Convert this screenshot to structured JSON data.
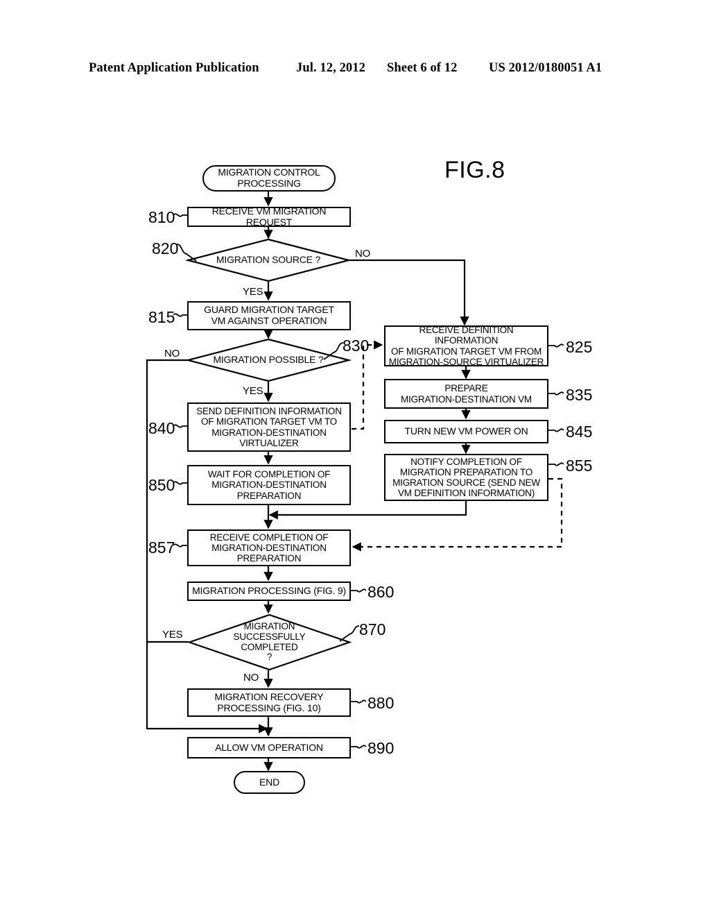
{
  "header": {
    "publication": "Patent Application Publication",
    "date": "Jul. 12, 2012",
    "sheet": "Sheet 6 of 12",
    "patent_number": "US 2012/0180051 A1"
  },
  "figure": {
    "title": "FIG.8"
  },
  "chart_data": {
    "type": "diagram",
    "title": "FIG.8",
    "nodes": [
      {
        "id": "start",
        "ref": "",
        "shape": "terminator",
        "text": "MIGRATION CONTROL PROCESSING"
      },
      {
        "id": "810",
        "ref": "810",
        "shape": "process",
        "text": "RECEIVE VM MIGRATION REQUEST"
      },
      {
        "id": "820",
        "ref": "820",
        "shape": "decision",
        "text": "MIGRATION SOURCE ?"
      },
      {
        "id": "815",
        "ref": "815",
        "shape": "process",
        "text": "GUARD MIGRATION TARGET VM AGAINST OPERATION"
      },
      {
        "id": "830",
        "ref": "830",
        "shape": "decision",
        "text": "MIGRATION POSSIBLE ?"
      },
      {
        "id": "840",
        "ref": "840",
        "shape": "process",
        "text": "SEND DEFINITION INFORMATION OF MIGRATION TARGET VM TO MIGRATION-DESTINATION VIRTUALIZER"
      },
      {
        "id": "850",
        "ref": "850",
        "shape": "process",
        "text": "WAIT FOR COMPLETION OF MIGRATION-DESTINATION PREPARATION"
      },
      {
        "id": "857",
        "ref": "857",
        "shape": "process",
        "text": "RECEIVE COMPLETION OF MIGRATION-DESTINATION PREPARATION"
      },
      {
        "id": "860",
        "ref": "860",
        "shape": "process",
        "text": "MIGRATION PROCESSING (FIG. 9)"
      },
      {
        "id": "870",
        "ref": "870",
        "shape": "decision",
        "text": "MIGRATION SUCCESSFULLY COMPLETED ?"
      },
      {
        "id": "880",
        "ref": "880",
        "shape": "process",
        "text": "MIGRATION RECOVERY PROCESSING (FIG. 10)"
      },
      {
        "id": "890",
        "ref": "890",
        "shape": "process",
        "text": "ALLOW VM OPERATION"
      },
      {
        "id": "end",
        "ref": "",
        "shape": "terminator",
        "text": "END"
      },
      {
        "id": "825",
        "ref": "825",
        "shape": "process",
        "text": "RECEIVE DEFINITION INFORMATION OF MIGRATION TARGET VM FROM MIGRATION-SOURCE VIRTUALIZER"
      },
      {
        "id": "835",
        "ref": "835",
        "shape": "process",
        "text": "PREPARE MIGRATION-DESTINATION VM"
      },
      {
        "id": "845",
        "ref": "845",
        "shape": "process",
        "text": "TURN NEW VM POWER ON"
      },
      {
        "id": "855",
        "ref": "855",
        "shape": "process",
        "text": "NOTIFY COMPLETION OF MIGRATION PREPARATION TO MIGRATION SOURCE (SEND NEW VM DEFINITION INFORMATION)"
      }
    ],
    "edges": [
      {
        "from": "start",
        "to": "810",
        "label": ""
      },
      {
        "from": "810",
        "to": "820",
        "label": ""
      },
      {
        "from": "820",
        "to": "815",
        "label": "YES"
      },
      {
        "from": "820",
        "to": "825",
        "label": "NO"
      },
      {
        "from": "815",
        "to": "830",
        "label": ""
      },
      {
        "from": "830",
        "to": "840",
        "label": "YES"
      },
      {
        "from": "830",
        "to": "890",
        "label": "NO"
      },
      {
        "from": "840",
        "to": "850",
        "label": ""
      },
      {
        "from": "840",
        "to": "825",
        "label": "",
        "style": "dashed"
      },
      {
        "from": "850",
        "to": "857",
        "label": ""
      },
      {
        "from": "825",
        "to": "835",
        "label": ""
      },
      {
        "from": "835",
        "to": "845",
        "label": ""
      },
      {
        "from": "845",
        "to": "855",
        "label": ""
      },
      {
        "from": "855",
        "to": "857",
        "label": ""
      },
      {
        "from": "855",
        "to": "857",
        "label": "",
        "style": "dashed"
      },
      {
        "from": "857",
        "to": "860",
        "label": ""
      },
      {
        "from": "860",
        "to": "870",
        "label": ""
      },
      {
        "from": "870",
        "to": "890",
        "label": "YES"
      },
      {
        "from": "870",
        "to": "880",
        "label": "NO"
      },
      {
        "from": "880",
        "to": "890",
        "label": ""
      },
      {
        "from": "890",
        "to": "end",
        "label": ""
      }
    ]
  },
  "nodes": {
    "start": {
      "text": "MIGRATION CONTROL\nPROCESSING"
    },
    "n810": {
      "ref": "810",
      "text": "RECEIVE VM MIGRATION REQUEST"
    },
    "n820": {
      "ref": "820",
      "text": "MIGRATION SOURCE ?"
    },
    "n815": {
      "ref": "815",
      "text": "GUARD MIGRATION TARGET\nVM AGAINST OPERATION"
    },
    "n830": {
      "ref": "830",
      "text": "MIGRATION POSSIBLE ?"
    },
    "n840": {
      "ref": "840",
      "text": "SEND DEFINITION INFORMATION\nOF MIGRATION TARGET VM TO\nMIGRATION-DESTINATION\nVIRTUALIZER"
    },
    "n850": {
      "ref": "850",
      "text": "WAIT FOR COMPLETION OF\nMIGRATION-DESTINATION\nPREPARATION"
    },
    "n857": {
      "ref": "857",
      "text": "RECEIVE COMPLETION OF\nMIGRATION-DESTINATION\nPREPARATION"
    },
    "n860": {
      "ref": "860",
      "text": "MIGRATION PROCESSING (FIG. 9)"
    },
    "n870": {
      "ref": "870",
      "text": "MIGRATION\nSUCCESSFULLY\nCOMPLETED\n?"
    },
    "n880": {
      "ref": "880",
      "text": "MIGRATION RECOVERY\nPROCESSING (FIG. 10)"
    },
    "n890": {
      "ref": "890",
      "text": "ALLOW VM OPERATION"
    },
    "end": {
      "text": "END"
    },
    "n825": {
      "ref": "825",
      "text": "RECEIVE DEFINITION INFORMATION\nOF MIGRATION TARGET VM FROM\nMIGRATION-SOURCE VIRTUALIZER"
    },
    "n835": {
      "ref": "835",
      "text": "PREPARE\nMIGRATION-DESTINATION VM"
    },
    "n845": {
      "ref": "845",
      "text": "TURN NEW VM POWER ON"
    },
    "n855": {
      "ref": "855",
      "text": "NOTIFY COMPLETION OF\nMIGRATION PREPARATION TO\nMIGRATION SOURCE (SEND NEW\nVM DEFINITION INFORMATION)"
    }
  },
  "branch_labels": {
    "b820_no": "NO",
    "b820_yes": "YES",
    "b830_no": "NO",
    "b830_yes": "YES",
    "b870_yes": "YES",
    "b870_no": "NO"
  },
  "ref_marks": {
    "r810": "810",
    "r820": "820",
    "r815": "815",
    "r830": "830",
    "r840": "840",
    "r850": "850",
    "r857": "857",
    "r860": "860",
    "r870": "870",
    "r880": "880",
    "r890": "890",
    "r825": "825",
    "r835": "835",
    "r845": "845",
    "r855": "855"
  }
}
